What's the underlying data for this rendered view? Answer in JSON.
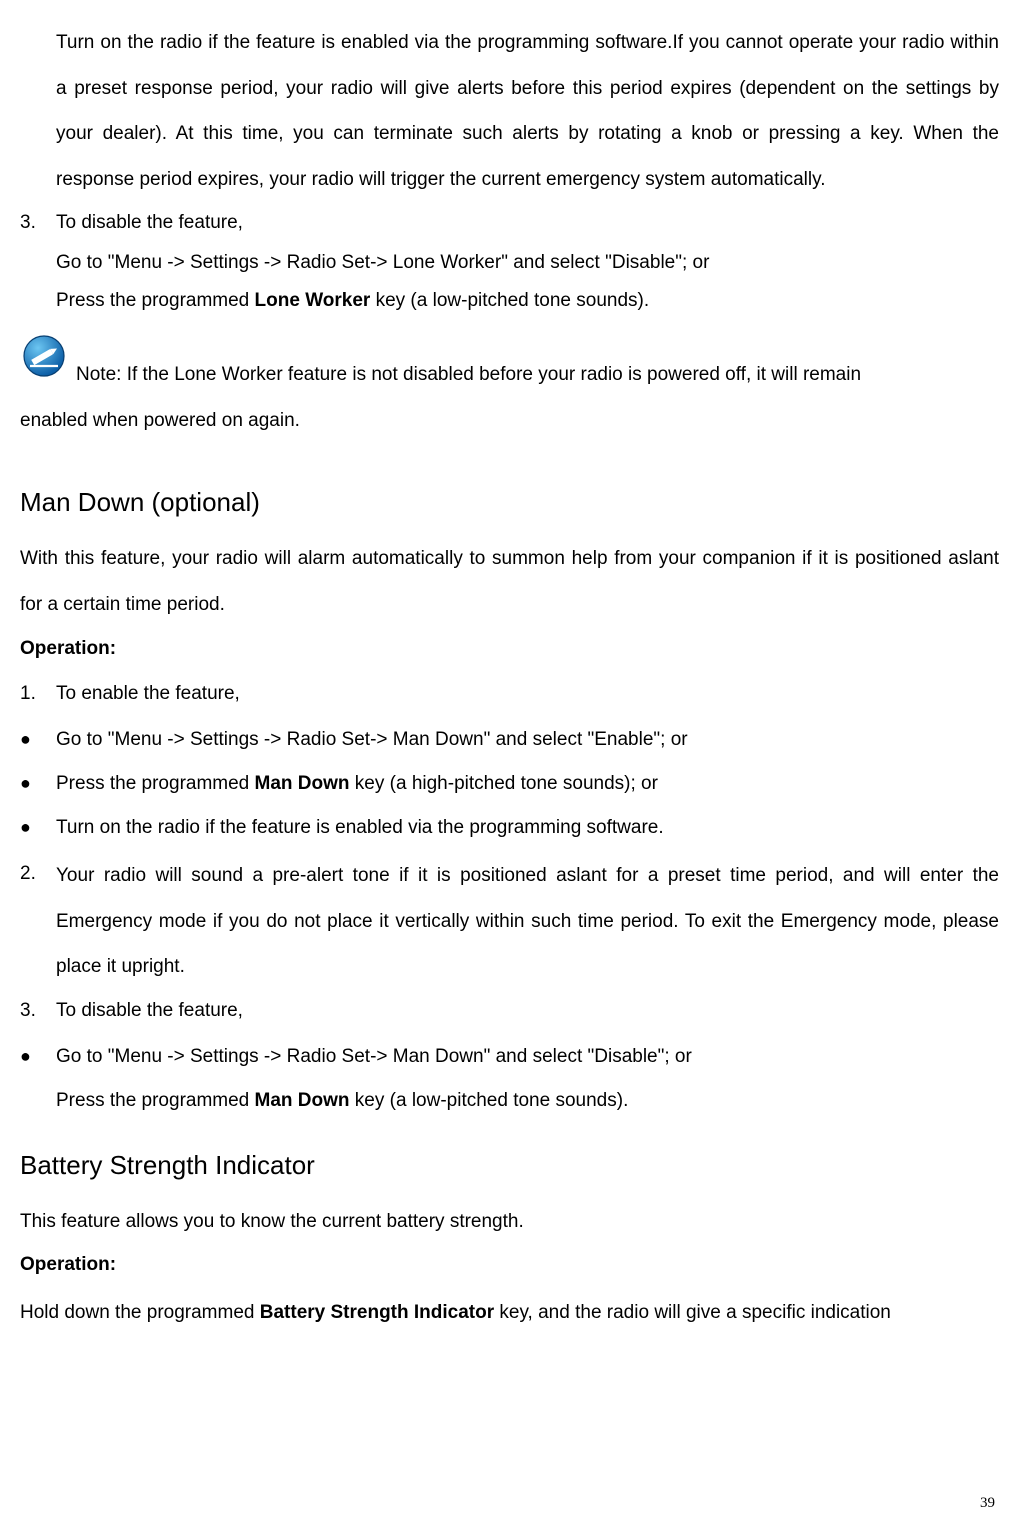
{
  "top": {
    "para1": "Turn on the radio if the feature is enabled via the programming software.If you cannot operate your radio within a preset response period, your radio will give alerts before this period expires (dependent on the settings by your dealer). At this time, you can terminate such alerts by rotating a knob or pressing a key. When the response period expires, your radio will trigger the current emergency system automatically.",
    "item3_num": "3.",
    "item3_line1": "To disable the feature,",
    "item3_line2": "Go to \"Menu -> Settings -> Radio Set-> Lone Worker\" and select \"Disable\"; or",
    "item3_line3a": "Press the programmed ",
    "item3_line3b_bold": "Lone Worker",
    "item3_line3c": " key (a low-pitched tone sounds)."
  },
  "note": {
    "line1": " Note: If the Lone Worker feature is not disabled before your radio is powered off, it will remain",
    "line2": "enabled when powered on again."
  },
  "mandown": {
    "heading": "Man Down (optional)",
    "intro": "With this feature, your radio will alarm automatically to summon help from your companion if it is positioned aslant for a certain time period.",
    "op_label": "Operation:",
    "n1": "1.",
    "n1_text": "To enable the feature,",
    "b1": "Go to \"Menu -> Settings -> Radio Set-> Man Down\" and select \"Enable\"; or",
    "b2a": "Press the programmed ",
    "b2b_bold": "Man Down",
    "b2c": " key (a high-pitched tone sounds); or",
    "b3": "Turn on the radio if the feature is enabled via the programming software.",
    "n2": "2.",
    "n2_text": "Your radio will sound a pre-alert tone if it is positioned aslant for a preset time period, and will enter the Emergency mode if you do not place it vertically within such time period. To exit the Emergency mode, please place it upright.",
    "n3": "3.",
    "n3_text": "To disable the feature,",
    "b4": "Go to \"Menu -> Settings -> Radio Set-> Man Down\" and select \"Disable\"; or",
    "b5a": "Press the programmed ",
    "b5b_bold": "Man Down",
    "b5c": " key (a low-pitched tone sounds)."
  },
  "battery": {
    "heading": "Battery Strength Indicator",
    "intro": "This feature allows you to know the current battery strength.",
    "op_label": "Operation:",
    "line_a": "Hold down the programmed ",
    "line_b_bold": "Battery Strength Indicator",
    "line_c": " key, and the radio will give a specific indication"
  },
  "page_number": "39",
  "bullet_char": "●"
}
